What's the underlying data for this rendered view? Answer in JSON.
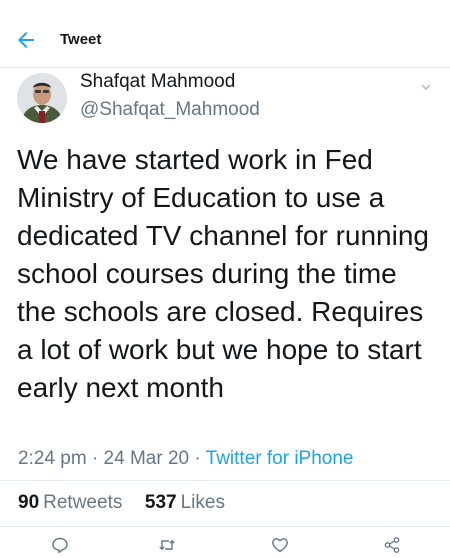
{
  "header": {
    "back_icon": "arrow-left-icon",
    "title": "Tweet"
  },
  "author": {
    "name": "Shafqat Mahmood",
    "handle": "@Shafqat_Mahmood",
    "avatar_icon": "profile-photo",
    "menu_icon": "chevron-down-icon"
  },
  "tweet": {
    "text": "We have started work in Fed Ministry of Education to use a dedicated TV channel for running school courses during the time the schools are closed. Requires a lot of work but we hope to start early next month",
    "time": "2:24 pm",
    "date": "24 Mar 20",
    "separator": "·",
    "source": "Twitter for iPhone"
  },
  "stats": {
    "retweets_count": "90",
    "retweets_label": "Retweets",
    "likes_count": "537",
    "likes_label": "Likes"
  },
  "actions": {
    "reply_icon": "reply-icon",
    "retweet_icon": "retweet-icon",
    "like_icon": "heart-icon",
    "share_icon": "share-icon"
  },
  "colors": {
    "accent": "#1da1f2",
    "text": "#14171a",
    "secondary": "#657786",
    "divider": "#e6ecf0"
  }
}
